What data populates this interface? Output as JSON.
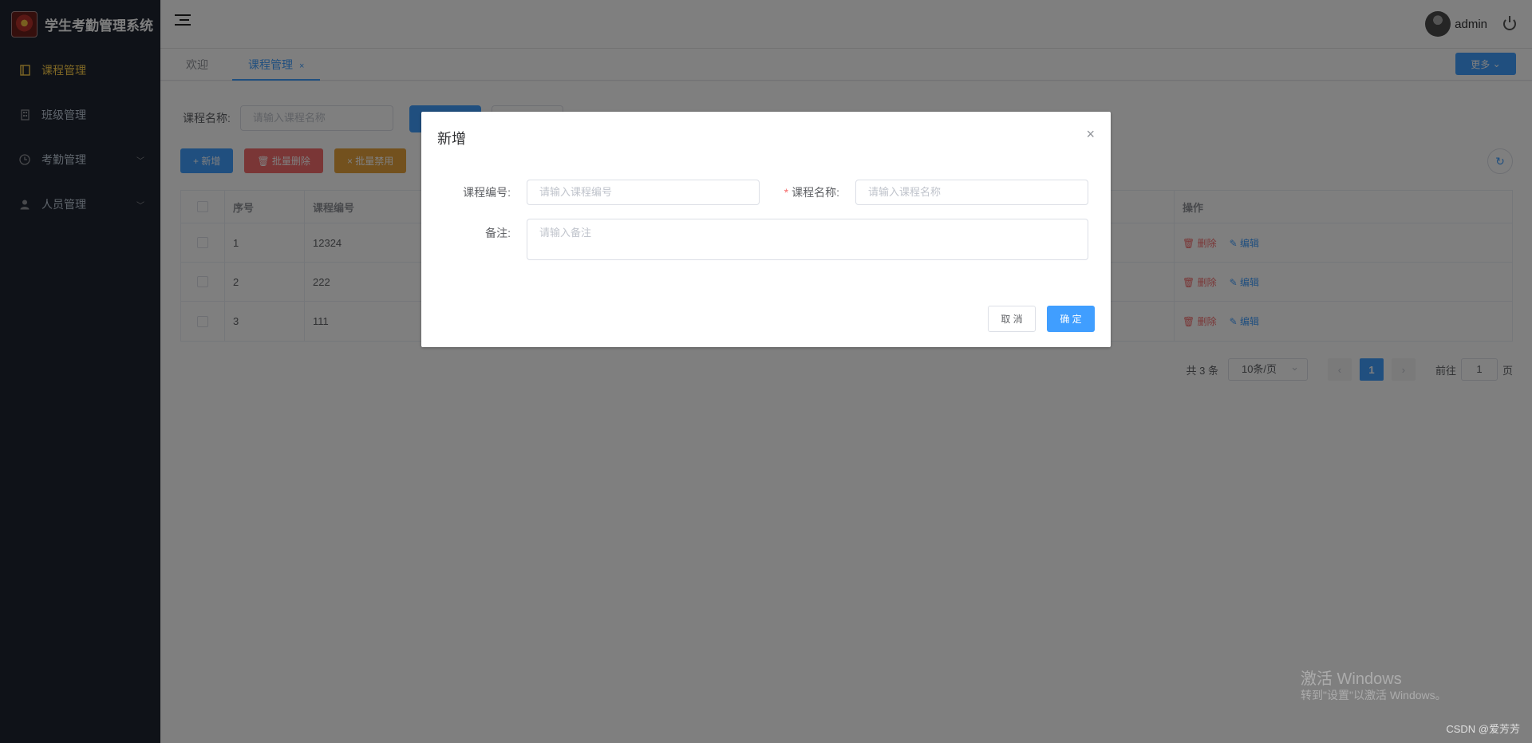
{
  "app": {
    "title": "学生考勤管理系统"
  },
  "sidebar": {
    "items": [
      {
        "label": "课程管理",
        "icon": "book-icon",
        "active": true
      },
      {
        "label": "班级管理",
        "icon": "building-icon",
        "active": false
      },
      {
        "label": "考勤管理",
        "icon": "clock-icon",
        "active": false,
        "expandable": true
      },
      {
        "label": "人员管理",
        "icon": "user-icon",
        "active": false,
        "expandable": true
      }
    ]
  },
  "header": {
    "username": "admin"
  },
  "tabs": {
    "items": [
      {
        "label": "欢迎"
      },
      {
        "label": "课程管理",
        "close": "×"
      }
    ],
    "more_label": "更多"
  },
  "search": {
    "label": "课程名称:",
    "placeholder": "请输入课程名称"
  },
  "toolbar": {
    "add_label": "+ 新增",
    "batch_delete_label": "批量删除",
    "batch_disable_label": "× 批量禁用"
  },
  "table": {
    "headers": [
      "序号",
      "课程编号",
      "操作"
    ],
    "rows": [
      {
        "index": "1",
        "code": "12324"
      },
      {
        "index": "2",
        "code": "222"
      },
      {
        "index": "3",
        "code": "111"
      }
    ],
    "delete_label": "删除",
    "edit_label": "编辑"
  },
  "pagination": {
    "total": "共 3 条",
    "page_size": "10条/页",
    "current_page": "1",
    "goto_label": "前往",
    "goto_value": "1",
    "page_unit": "页"
  },
  "dialog": {
    "title": "新增",
    "close": "×",
    "code_label": "课程编号:",
    "code_placeholder": "请输入课程编号",
    "required_mark": "*",
    "name_label": "课程名称:",
    "name_placeholder": "请输入课程名称",
    "remark_label": "备注:",
    "remark_placeholder": "请输入备注",
    "cancel_label": "取 消",
    "ok_label": "确 定"
  },
  "watermark": {
    "line1": "激活 Windows",
    "line2": "转到\"设置\"以激活 Windows。",
    "credit": "CSDN @爱芳芳"
  },
  "colors": {
    "primary": "#409eff",
    "danger": "#f56c6c",
    "warning": "#e6a23c",
    "sidebar_bg": "#1f2430",
    "active_menu": "#ffd04b"
  }
}
